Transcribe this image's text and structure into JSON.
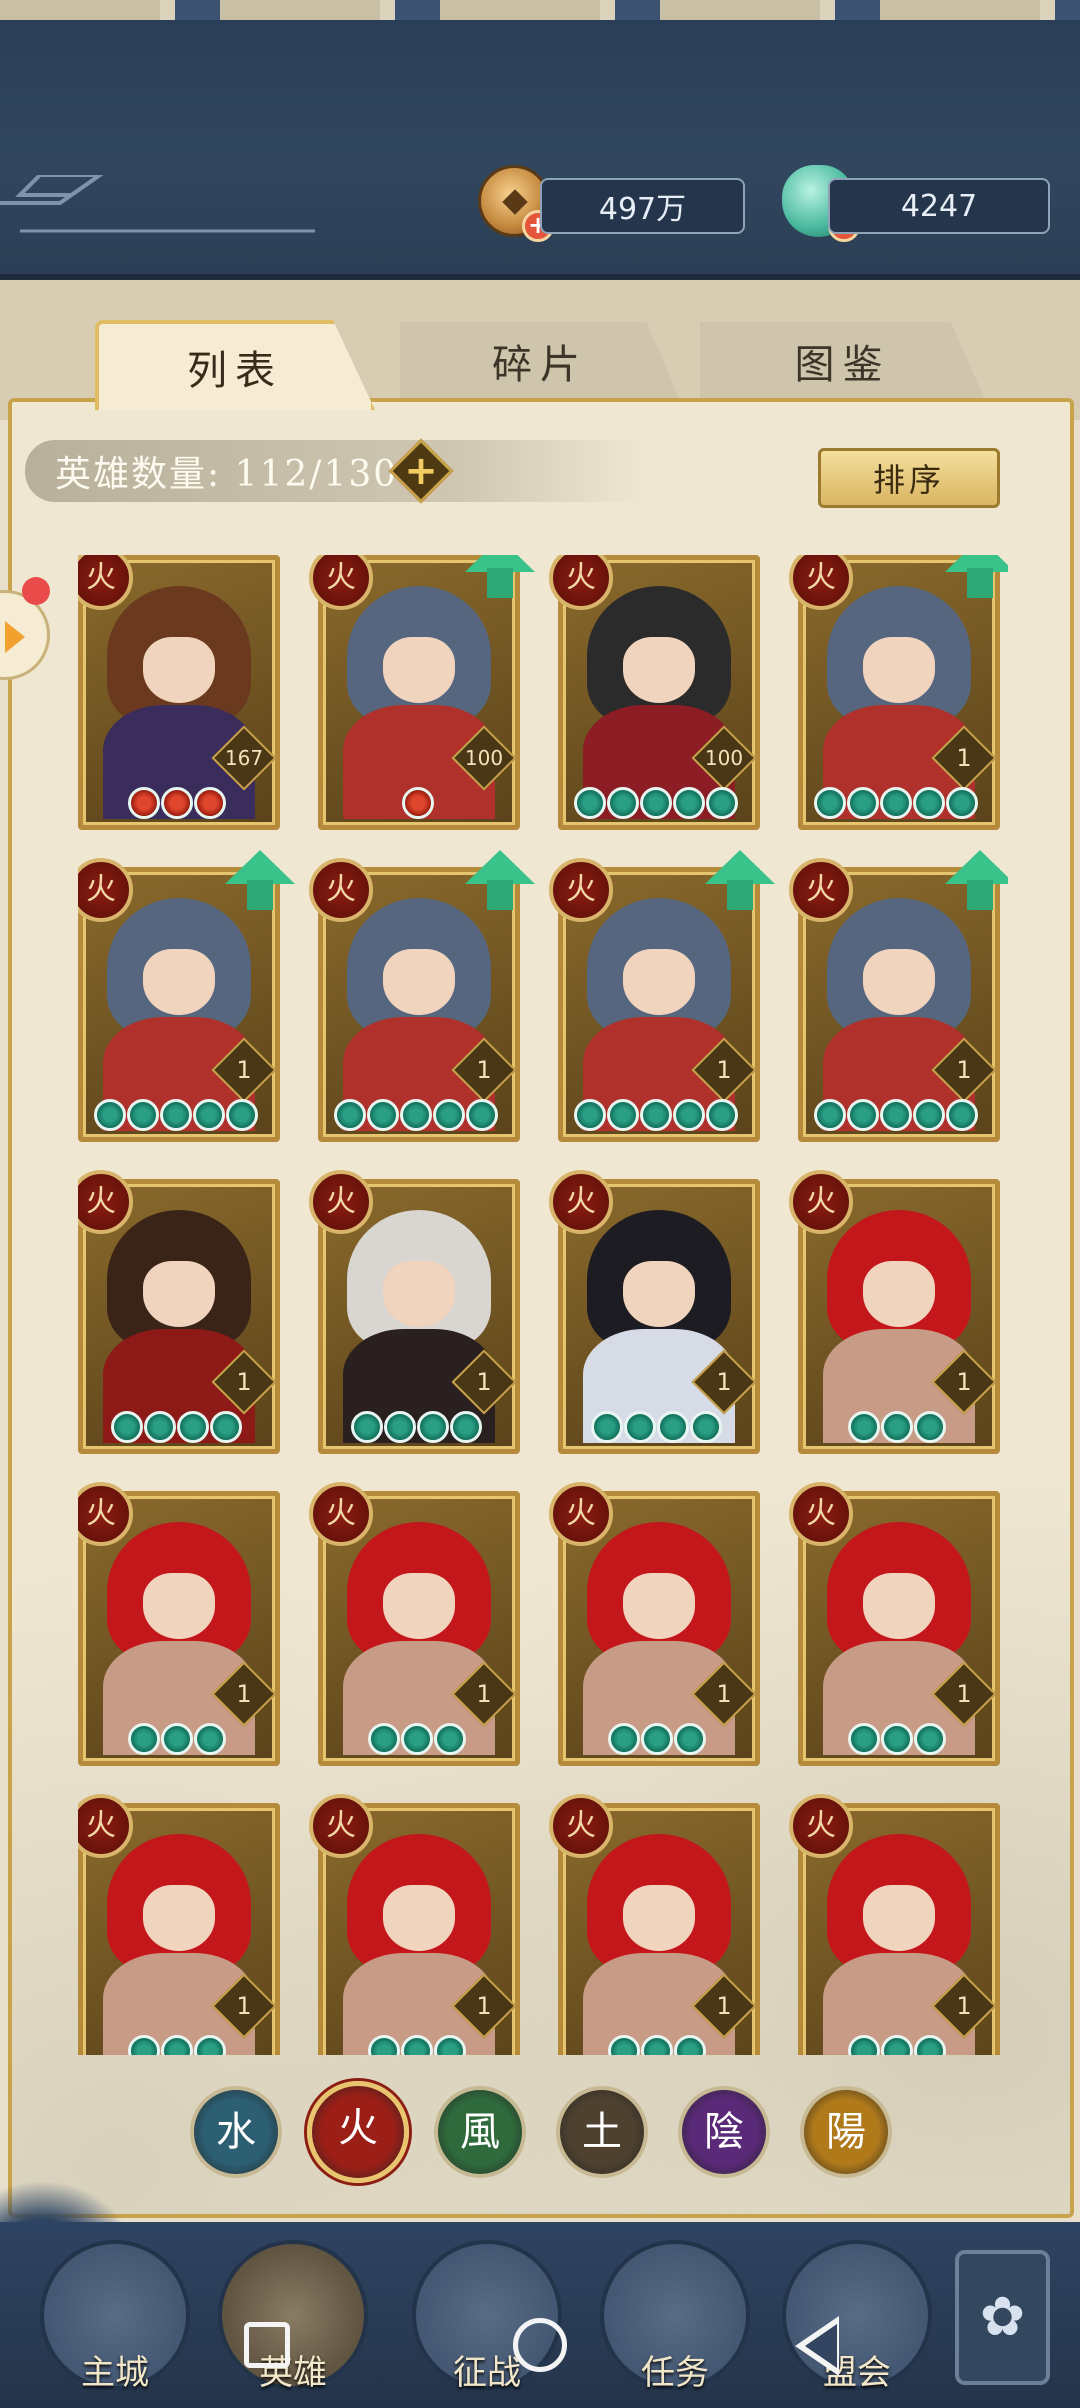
{
  "resources": {
    "coins": {
      "value": "497万",
      "icon": "copper-coin-icon"
    },
    "jade": {
      "value": "4247",
      "icon": "jade-pouch-icon"
    }
  },
  "tabs": [
    {
      "label": "列表",
      "active": true
    },
    {
      "label": "碎片",
      "active": false
    },
    {
      "label": "图鉴",
      "active": false
    }
  ],
  "hero_count": {
    "text": "英雄数量: 112/130"
  },
  "sort_button": "排序",
  "heroes": [
    {
      "level": "167",
      "stars": 3,
      "star_type": "red",
      "upgrade": false,
      "element": "火",
      "hair": "#6b3a1e",
      "outfit": "#3a2d5c"
    },
    {
      "level": "100",
      "stars": 1,
      "star_type": "red",
      "upgrade": true,
      "element": "火",
      "hair": "#55667e",
      "outfit": "#b0312c"
    },
    {
      "level": "100",
      "stars": 5,
      "star_type": "jade",
      "upgrade": false,
      "element": "火",
      "hair": "#2b2b2b",
      "outfit": "#8c1d25"
    },
    {
      "level": "1",
      "stars": 5,
      "star_type": "jade",
      "upgrade": true,
      "element": "火",
      "hair": "#55667e",
      "outfit": "#b0312c"
    },
    {
      "level": "1",
      "stars": 5,
      "star_type": "jade",
      "upgrade": true,
      "element": "火",
      "hair": "#55667e",
      "outfit": "#b0312c"
    },
    {
      "level": "1",
      "stars": 5,
      "star_type": "jade",
      "upgrade": true,
      "element": "火",
      "hair": "#55667e",
      "outfit": "#b0312c"
    },
    {
      "level": "1",
      "stars": 5,
      "star_type": "jade",
      "upgrade": true,
      "element": "火",
      "hair": "#55667e",
      "outfit": "#b0312c"
    },
    {
      "level": "1",
      "stars": 5,
      "star_type": "jade",
      "upgrade": true,
      "element": "火",
      "hair": "#55667e",
      "outfit": "#b0312c"
    },
    {
      "level": "1",
      "stars": 4,
      "star_type": "jade",
      "upgrade": false,
      "element": "火",
      "hair": "#3a2418",
      "outfit": "#8e1a18"
    },
    {
      "level": "1",
      "stars": 4,
      "star_type": "jade",
      "upgrade": false,
      "element": "火",
      "hair": "#d9d6d2",
      "outfit": "#2a2020"
    },
    {
      "level": "1",
      "stars": 4,
      "star_type": "jade",
      "upgrade": false,
      "element": "火",
      "hair": "#1c1c22",
      "outfit": "#d7dbe6"
    },
    {
      "level": "1",
      "stars": 3,
      "star_type": "jade",
      "upgrade": false,
      "element": "火",
      "hair": "#c3171c",
      "outfit": "#c79b86"
    },
    {
      "level": "1",
      "stars": 3,
      "star_type": "jade",
      "upgrade": false,
      "element": "火",
      "hair": "#c3171c",
      "outfit": "#c79b86"
    },
    {
      "level": "1",
      "stars": 3,
      "star_type": "jade",
      "upgrade": false,
      "element": "火",
      "hair": "#c3171c",
      "outfit": "#c79b86"
    },
    {
      "level": "1",
      "stars": 3,
      "star_type": "jade",
      "upgrade": false,
      "element": "火",
      "hair": "#c3171c",
      "outfit": "#c79b86"
    },
    {
      "level": "1",
      "stars": 3,
      "star_type": "jade",
      "upgrade": false,
      "element": "火",
      "hair": "#c3171c",
      "outfit": "#c79b86"
    },
    {
      "level": "1",
      "stars": 3,
      "star_type": "jade",
      "upgrade": false,
      "element": "火",
      "hair": "#c3171c",
      "outfit": "#c79b86"
    },
    {
      "level": "1",
      "stars": 3,
      "star_type": "jade",
      "upgrade": false,
      "element": "火",
      "hair": "#c3171c",
      "outfit": "#c79b86"
    },
    {
      "level": "1",
      "stars": 3,
      "star_type": "jade",
      "upgrade": false,
      "element": "火",
      "hair": "#c3171c",
      "outfit": "#c79b86"
    },
    {
      "level": "1",
      "stars": 3,
      "star_type": "jade",
      "upgrade": false,
      "element": "火",
      "hair": "#c3171c",
      "outfit": "#c79b86"
    }
  ],
  "elements": [
    {
      "glyph": "水",
      "name": "water",
      "color": "#2d5f73",
      "active": false
    },
    {
      "glyph": "火",
      "name": "fire",
      "color": "#9b1f17",
      "active": true
    },
    {
      "glyph": "風",
      "name": "wind",
      "color": "#2f6a3c",
      "active": false
    },
    {
      "glyph": "土",
      "name": "earth",
      "color": "#4e4130",
      "active": false
    },
    {
      "glyph": "陰",
      "name": "yin",
      "color": "#5a2a78",
      "active": false
    },
    {
      "glyph": "陽",
      "name": "yang",
      "color": "#b07a1b",
      "active": false
    }
  ],
  "nav": [
    {
      "label": "主城",
      "name": "main-city"
    },
    {
      "label": "英雄",
      "name": "heroes"
    },
    {
      "label": "征战",
      "name": "campaign"
    },
    {
      "label": "任务",
      "name": "tasks"
    },
    {
      "label": "盟会",
      "name": "guild"
    }
  ],
  "colors": {
    "accent_gold": "#c9a24c",
    "panel": "#efe7d2",
    "banner": "#31475f"
  }
}
